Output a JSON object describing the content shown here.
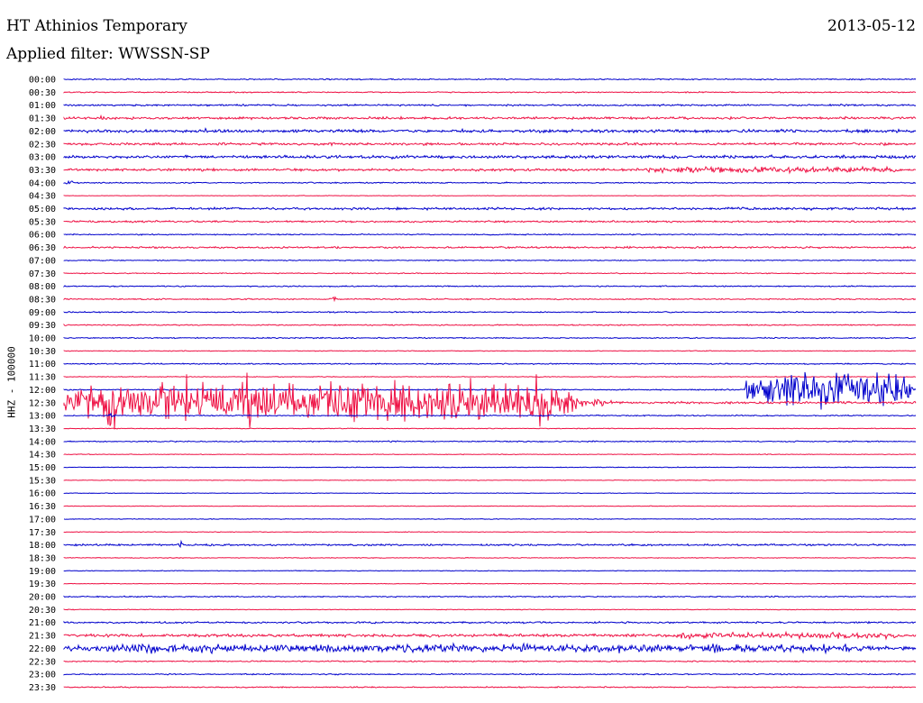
{
  "header": {
    "station": "HT Athinios Temporary",
    "date": "2013-05-12",
    "filter": "Applied filter: WWSSN-SP",
    "channel": "HHZ - 100000"
  },
  "colors": {
    "even_rows": "#0000cc",
    "odd_rows": "#ee1144",
    "text": "#000000",
    "background": "#ffffff"
  },
  "chart_data": {
    "type": "line",
    "title": "HT Athinios Temporary",
    "ylabel": "HHZ - 100000",
    "row_labels": [
      "00:00",
      "00:30",
      "01:00",
      "01:30",
      "02:00",
      "02:30",
      "03:00",
      "03:30",
      "04:00",
      "04:30",
      "05:00",
      "05:30",
      "06:00",
      "06:30",
      "07:00",
      "07:30",
      "08:00",
      "08:30",
      "09:00",
      "09:30",
      "10:00",
      "10:30",
      "11:00",
      "11:30",
      "12:00",
      "12:30",
      "13:00",
      "13:30",
      "14:00",
      "14:30",
      "15:00",
      "15:30",
      "16:00",
      "16:30",
      "17:00",
      "17:30",
      "18:00",
      "18:30",
      "19:00",
      "19:30",
      "20:00",
      "20:30",
      "21:00",
      "21:30",
      "22:00",
      "22:30",
      "23:00",
      "23:30"
    ],
    "row_colors": [
      "blue",
      "red"
    ],
    "noise_level": [
      1,
      1,
      1.5,
      2,
      2.5,
      2,
      2.5,
      2,
      1,
      0.5,
      2,
      1.5,
      1,
      1.5,
      0.8,
      0.8,
      1,
      1,
      1,
      1,
      1,
      0.6,
      1,
      0.6,
      1,
      2,
      1,
      0.6,
      1,
      0.6,
      0.6,
      0.5,
      0.5,
      0.5,
      0.6,
      0.6,
      1.5,
      0.6,
      0.6,
      0.6,
      1,
      0.6,
      1.5,
      2.5,
      3,
      1,
      1,
      1
    ],
    "events": [
      {
        "row": "01:30",
        "at": 0.04,
        "amp": 7
      },
      {
        "row": "02:00",
        "at": 0.16,
        "amp": 6
      },
      {
        "row": "03:00",
        "at": 0.38,
        "amp": 6
      },
      {
        "row": "03:30",
        "at": 0.67,
        "amp": 5,
        "sustained_to": 1.0
      },
      {
        "row": "04:00",
        "at": 0.0,
        "amp": 6
      },
      {
        "row": "08:30",
        "at": 0.31,
        "amp": 7
      },
      {
        "row": "12:30",
        "at": 0.0,
        "amp": 40,
        "sustained_to": 0.62
      },
      {
        "row": "12:00",
        "at": 0.8,
        "amp": 30,
        "sustained_to": 1.0
      },
      {
        "row": "13:00",
        "at": 0.05,
        "amp": 6
      },
      {
        "row": "18:00",
        "at": 0.13,
        "amp": 6
      },
      {
        "row": "21:30",
        "at": 0.7,
        "amp": 5,
        "sustained_to": 1.0
      },
      {
        "row": "22:00",
        "at": 0.0,
        "amp": 7,
        "sustained_to": 1.0
      }
    ]
  }
}
